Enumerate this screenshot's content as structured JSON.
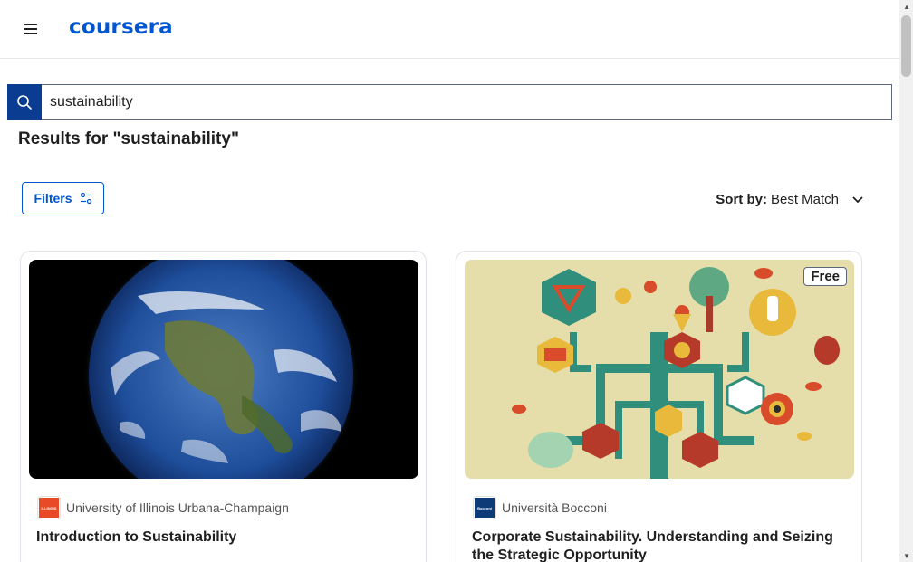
{
  "header": {
    "logo": "coursera",
    "menu_icon": "hamburger-menu-icon"
  },
  "search": {
    "value": "sustainability",
    "icon": "search-icon"
  },
  "results": {
    "title": "Results for \"sustainability\""
  },
  "filters": {
    "label": "Filters",
    "icon": "filter-sliders-icon"
  },
  "sort": {
    "prefix": "Sort by:",
    "value": "Best Match",
    "icon": "chevron-down-icon"
  },
  "cards": [
    {
      "partner": "University of Illinois Urbana-Champaign",
      "partner_logo_text": "ILLINOIS",
      "partner_color": "#e84a27",
      "title": "Introduction to Sustainability",
      "image": "earth-globe-image"
    },
    {
      "partner": "Università Bocconi",
      "partner_logo_text": "Bocconi",
      "partner_color": "#0c3b78",
      "title": "Corporate Sustainability. Understanding and Seizing the Strategic Opportunity",
      "badge": "Free",
      "image": "sustainability-tree-illustration"
    }
  ],
  "colors": {
    "brand": "#0056d2",
    "search_button": "#0a3d91"
  }
}
